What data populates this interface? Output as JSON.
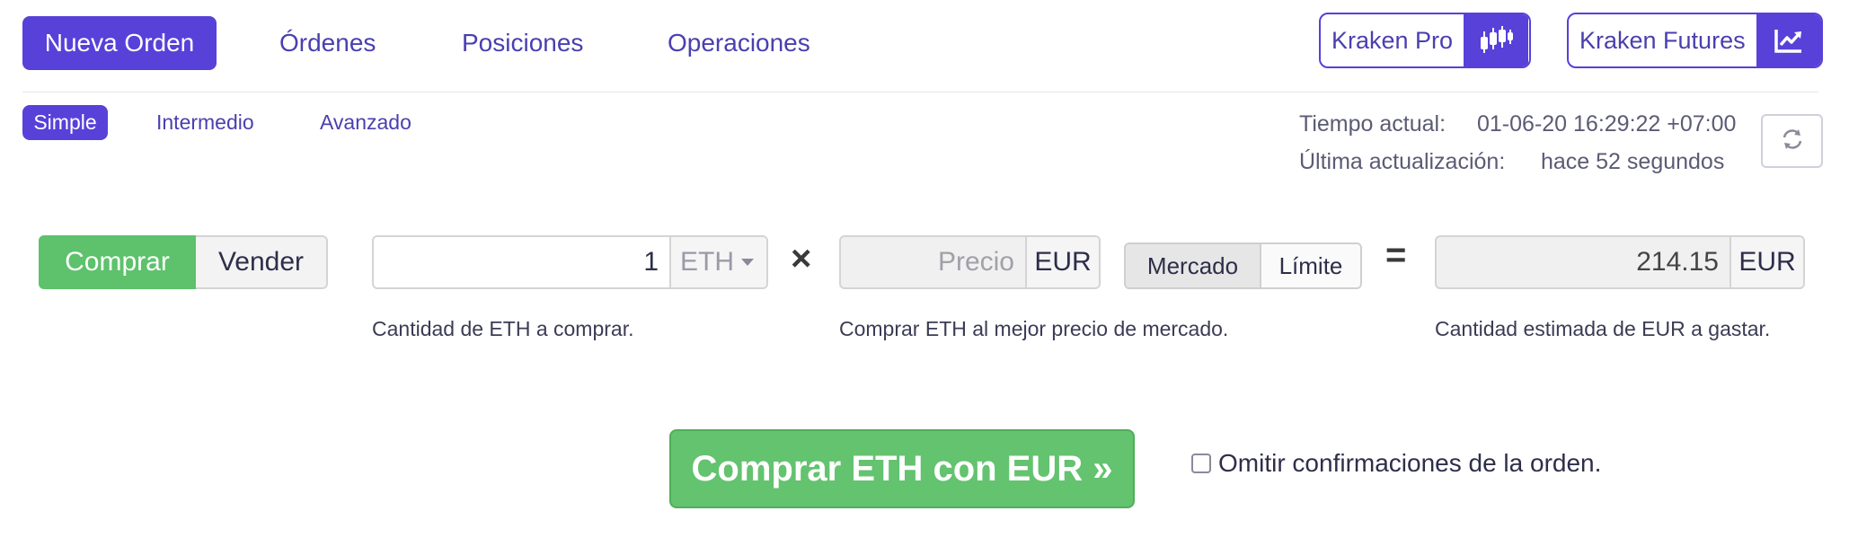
{
  "nav": {
    "tabs": [
      "Nueva Orden",
      "Órdenes",
      "Posiciones",
      "Operaciones"
    ],
    "kraken_pro": "Kraken Pro",
    "kraken_futures": "Kraken Futures"
  },
  "subtabs": [
    "Simple",
    "Intermedio",
    "Avanzado"
  ],
  "info": {
    "current_time_label": "Tiempo actual:",
    "current_time_value": "01-06-20 16:29:22 +07:00",
    "last_update_label": "Última actualización:",
    "last_update_value": "hace 52 segundos"
  },
  "order": {
    "buy_label": "Comprar",
    "sell_label": "Vender",
    "amount_value": "1",
    "amount_unit": "ETH",
    "amount_help": "Cantidad de ETH a comprar.",
    "multiply_symbol": "×",
    "price_placeholder": "Precio",
    "price_unit": "EUR",
    "price_help": "Comprar ETH al mejor precio de mercado.",
    "mode_market": "Mercado",
    "mode_limit": "Límite",
    "equals_symbol": "=",
    "total_value": "214.15",
    "total_unit": "EUR",
    "total_help": "Cantidad estimada de EUR a gastar."
  },
  "submit_label": "Comprar ETH con EUR »",
  "skip_confirm_label": "Omitir confirmaciones de la orden.",
  "colors": {
    "accent": "#5741d9",
    "buy_green": "#5dc26b"
  }
}
